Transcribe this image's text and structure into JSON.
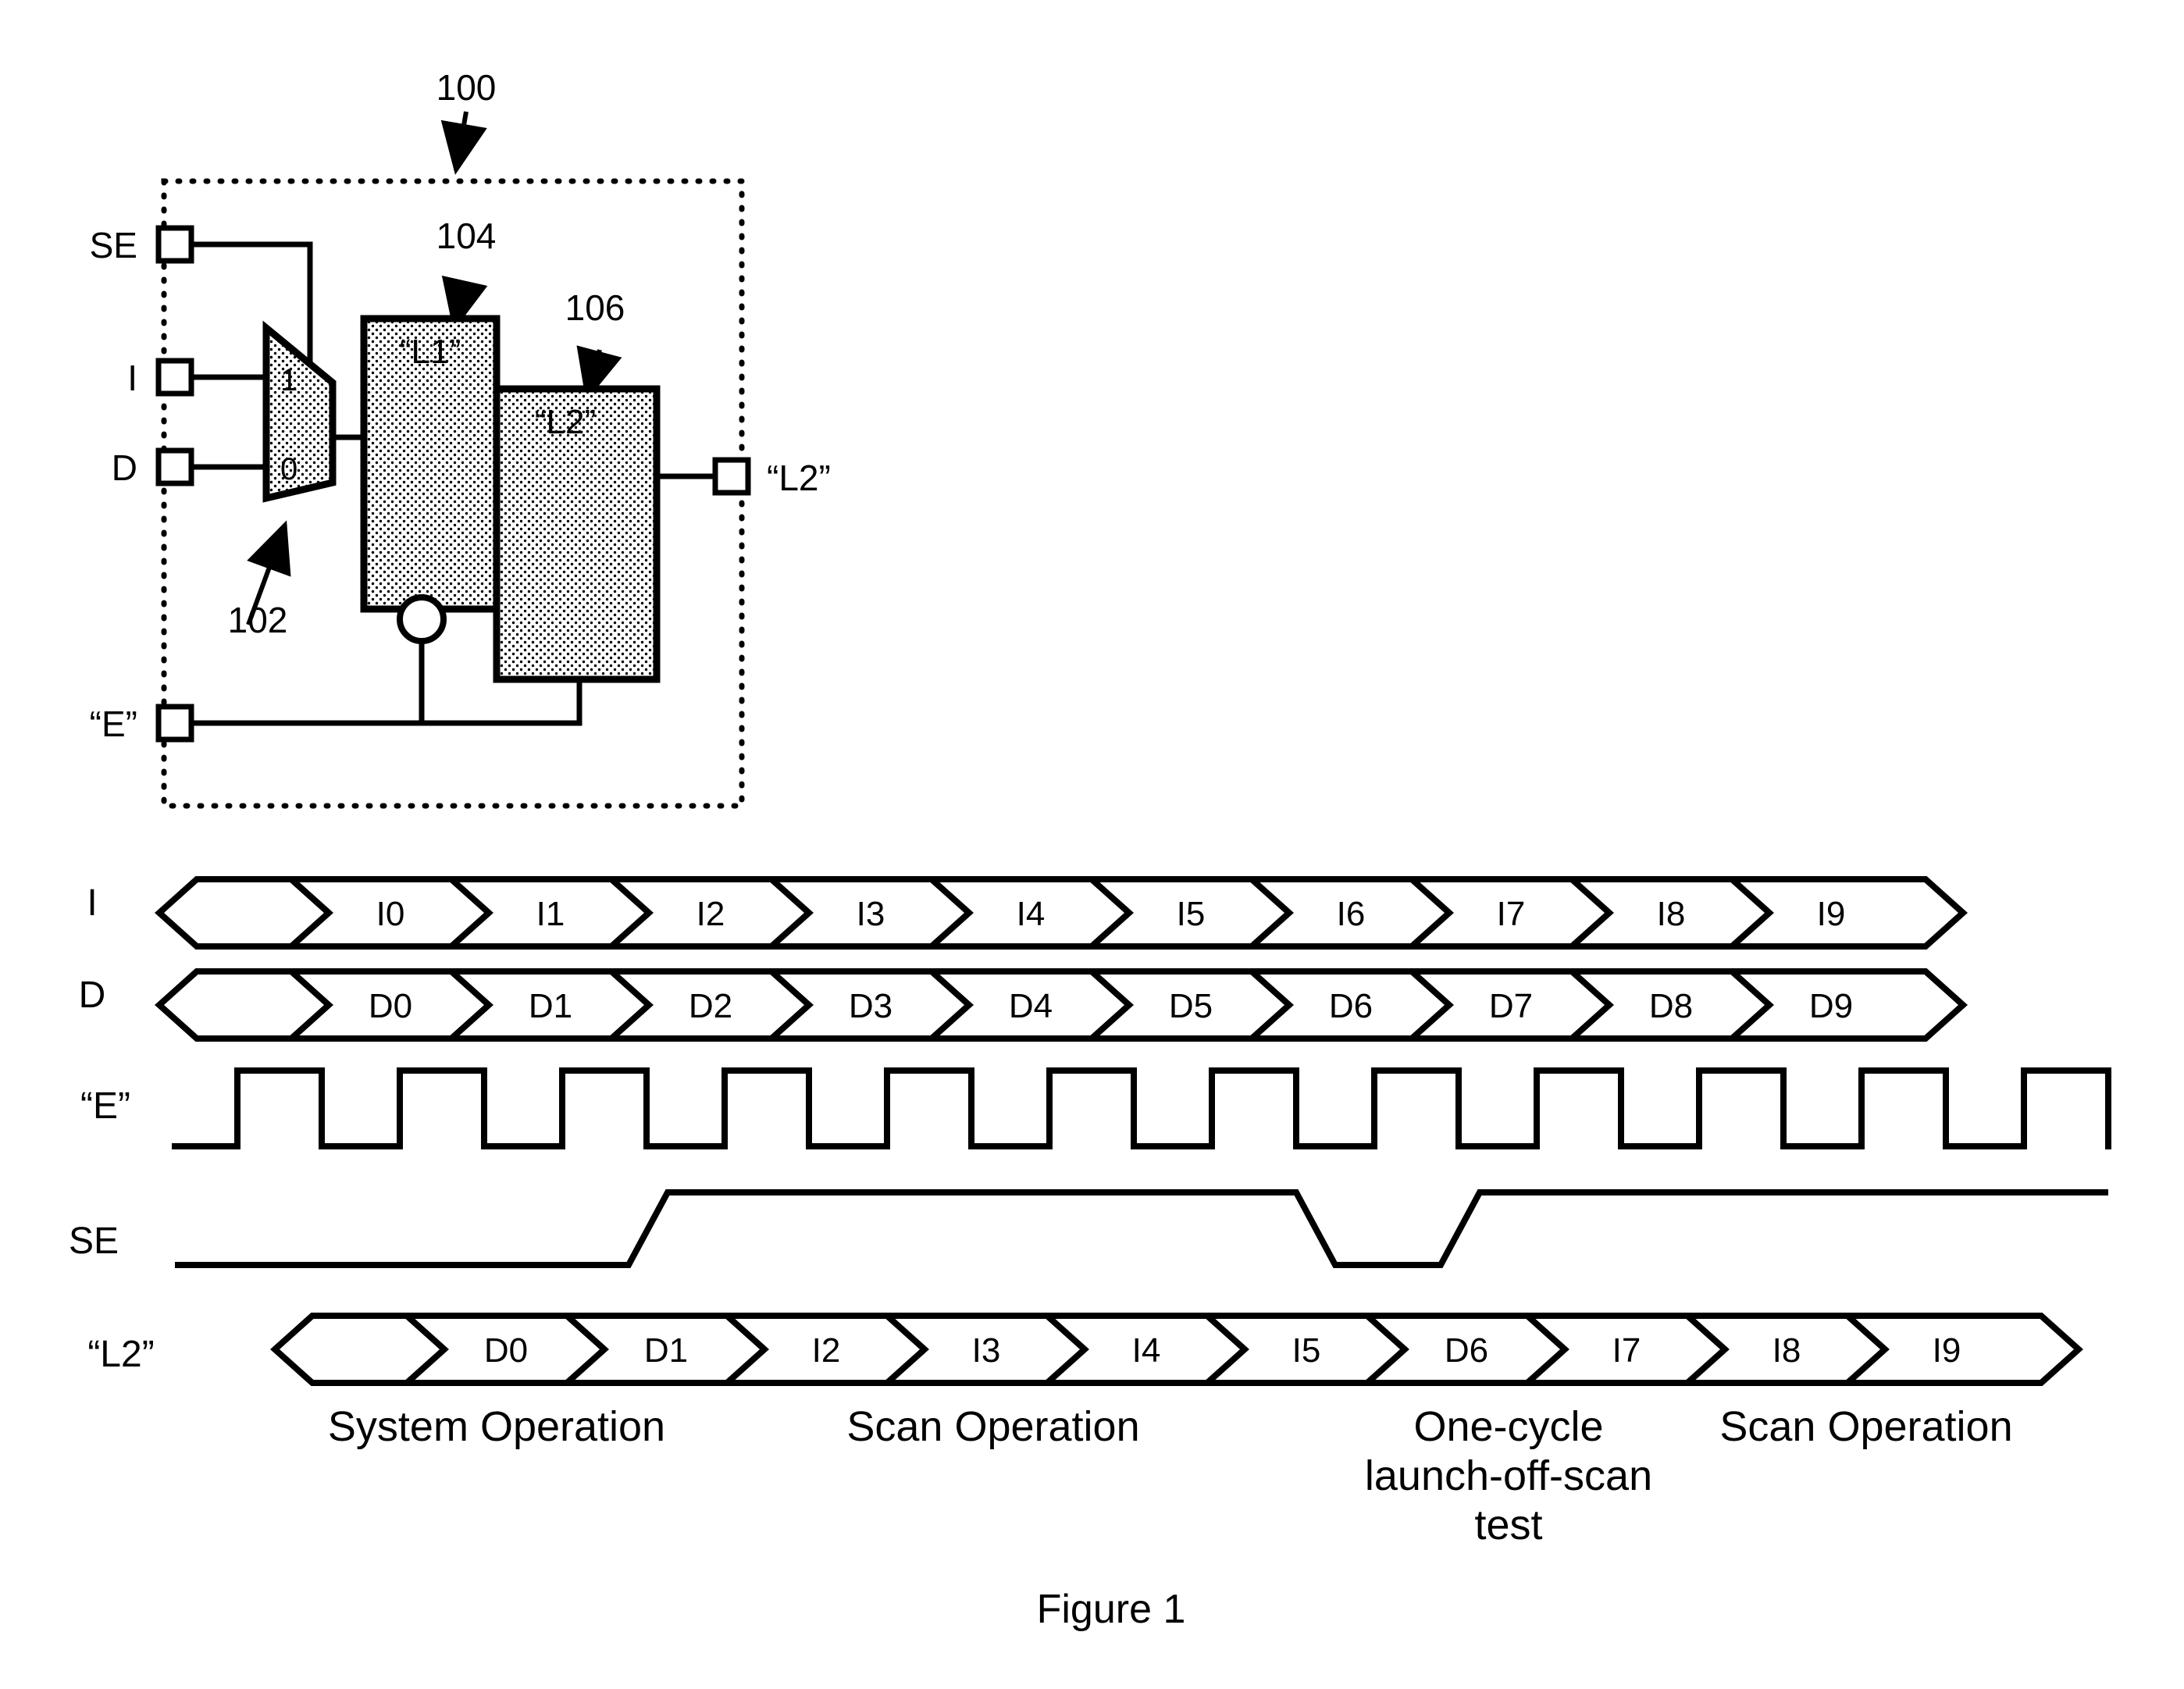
{
  "figure": {
    "caption": "Figure 1"
  },
  "schematic": {
    "reference_numerals": {
      "device": "100",
      "mux": "102",
      "latch_l1": "104",
      "latch_l2": "106"
    },
    "ports": {
      "scan_enable": "SE",
      "scan_in": "I",
      "data_in": "D",
      "clock": "“E”",
      "output": "“L2”"
    },
    "mux_inputs": {
      "select_one": "1",
      "select_zero": "0"
    },
    "blocks": {
      "l1_label": "“L1”",
      "l2_label": "“L2”"
    }
  },
  "timing": {
    "row_labels": {
      "scan_in": "I",
      "data_in": "D",
      "clock": "“E”",
      "scan_enable": "SE",
      "output": "“L2”"
    },
    "waveforms": {
      "scan_in_values": [
        "",
        "I0",
        "I1",
        "I2",
        "I3",
        "I4",
        "I5",
        "I6",
        "I7",
        "I8",
        "I9",
        ""
      ],
      "data_in_values": [
        "",
        "D0",
        "D1",
        "D2",
        "D3",
        "D4",
        "D5",
        "D6",
        "D7",
        "D8",
        "D9",
        ""
      ],
      "output_values": [
        "",
        "D0",
        "D1",
        "I2",
        "I3",
        "I4",
        "I5",
        "D6",
        "I7",
        "I8",
        "I9"
      ],
      "clock_pulse_count": 12,
      "scan_enable_levels": [
        "low",
        "high",
        "low",
        "high"
      ]
    },
    "phase_labels": [
      {
        "text": "System Operation",
        "lines": [
          "System Operation"
        ]
      },
      {
        "text": "Scan Operation",
        "lines": [
          "Scan Operation"
        ]
      },
      {
        "text": "One-cycle launch-off-scan test",
        "lines": [
          "One-cycle",
          "launch-off-scan",
          "test"
        ]
      },
      {
        "text": "Scan Operation",
        "lines": [
          "Scan Operation"
        ]
      }
    ]
  },
  "style": {
    "ink": "#000000",
    "paper": "#ffffff",
    "hatch": "#000000"
  }
}
